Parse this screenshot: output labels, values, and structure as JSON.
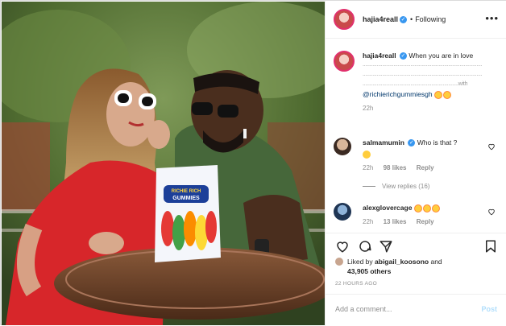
{
  "post": {
    "author": "hajia4reall",
    "follow_state": "Following",
    "separator": "•",
    "more_icon": "more-horizontal-icon"
  },
  "caption": {
    "text": "When you are in love",
    "dots_line_1": ".....................................................................................",
    "dots_line_2": ".....................................................................................",
    "dots_line_3": "....................................................................with",
    "mention": "@richierichgummiesgh",
    "time": "22h"
  },
  "comments": [
    {
      "user": "salmamumin",
      "text": "Who is that ?",
      "time": "22h",
      "likes": "98 likes",
      "reply": "Reply",
      "view_replies": "View replies (16)"
    },
    {
      "user": "alexglovercage",
      "text": "",
      "time": "22h",
      "likes": "13 likes",
      "reply": "Reply"
    }
  ],
  "likes": {
    "text_prefix": "Liked by ",
    "first_user": "abigail_koosono",
    "joiner": " and",
    "others": "43,905 others"
  },
  "timestamp": "22 HOURS AGO",
  "add_comment": {
    "placeholder": "Add a comment...",
    "post_label": "Post"
  },
  "photo": {
    "bag_line_1": "RICHIE RICH",
    "bag_line_2": "GUMMIES"
  },
  "colors": {
    "verified": "#3897f0",
    "mention": "#00376b",
    "muted": "#8e8e8e",
    "post_disabled": "#b2dffc"
  }
}
